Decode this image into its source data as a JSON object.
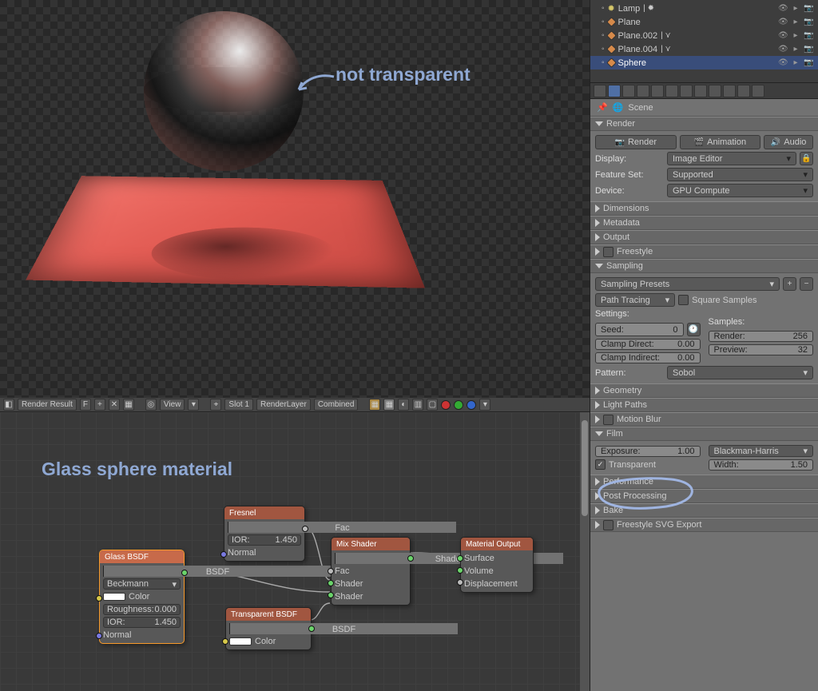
{
  "outliner": {
    "items": [
      {
        "icon": "lamp",
        "label": "Lamp"
      },
      {
        "icon": "obj",
        "label": "Plane"
      },
      {
        "icon": "obj",
        "label": "Plane.002"
      },
      {
        "icon": "obj",
        "label": "Plane.004"
      },
      {
        "icon": "obj",
        "label": "Sphere",
        "selected": true
      }
    ]
  },
  "breadcrumb": {
    "scene": "Scene"
  },
  "render": {
    "header": "Render",
    "buttons": {
      "render": "Render",
      "animation": "Animation",
      "audio": "Audio"
    },
    "display_label": "Display:",
    "display": "Image Editor",
    "featureset_label": "Feature Set:",
    "featureset": "Supported",
    "device_label": "Device:",
    "device": "GPU Compute"
  },
  "collapsed": {
    "dimensions": "Dimensions",
    "metadata": "Metadata",
    "output": "Output",
    "freestyle": "Freestyle",
    "geometry": "Geometry",
    "lightpaths": "Light Paths",
    "motionblur": "Motion Blur",
    "performance": "Performance",
    "postproc": "Post Processing",
    "bake": "Bake",
    "freestylesvg": "Freestyle SVG Export"
  },
  "sampling": {
    "header": "Sampling",
    "presets": "Sampling Presets",
    "integrator": "Path Tracing",
    "square": "Square Samples",
    "settings_label": "Settings:",
    "samples_label": "Samples:",
    "seed_label": "Seed:",
    "seed": "0",
    "clampd_label": "Clamp Direct:",
    "clampd": "0.00",
    "clampi_label": "Clamp Indirect:",
    "clampi": "0.00",
    "render_label": "Render:",
    "render": "256",
    "preview_label": "Preview:",
    "preview": "32",
    "pattern_label": "Pattern:",
    "pattern": "Sobol"
  },
  "film": {
    "header": "Film",
    "exposure_label": "Exposure:",
    "exposure": "1.00",
    "transparent": "Transparent",
    "filter": "Blackman-Harris",
    "width_label": "Width:",
    "width": "1.50"
  },
  "toolbar": {
    "render_result": "Render Result",
    "f": "F",
    "view": "View",
    "slot": "Slot 1",
    "layer": "RenderLayer",
    "pass": "Combined"
  },
  "annotation": {
    "not_transparent": "not transparent",
    "material_title": "Glass sphere material"
  },
  "nodes": {
    "glass": {
      "title": "Glass BSDF",
      "bsdf": "BSDF",
      "dist": "Beckmann",
      "color": "Color",
      "rough_label": "Roughness:",
      "rough": "0.000",
      "ior_label": "IOR:",
      "ior": "1.450",
      "normal": "Normal"
    },
    "fresnel": {
      "title": "Fresnel",
      "fac": "Fac",
      "ior_label": "IOR:",
      "ior": "1.450",
      "normal": "Normal"
    },
    "transp": {
      "title": "Transparent BSDF",
      "bsdf": "BSDF",
      "color": "Color"
    },
    "mix": {
      "title": "Mix Shader",
      "out": "Shader",
      "fac": "Fac",
      "s1": "Shader",
      "s2": "Shader"
    },
    "out": {
      "title": "Material Output",
      "surface": "Surface",
      "volume": "Volume",
      "disp": "Displacement"
    }
  }
}
